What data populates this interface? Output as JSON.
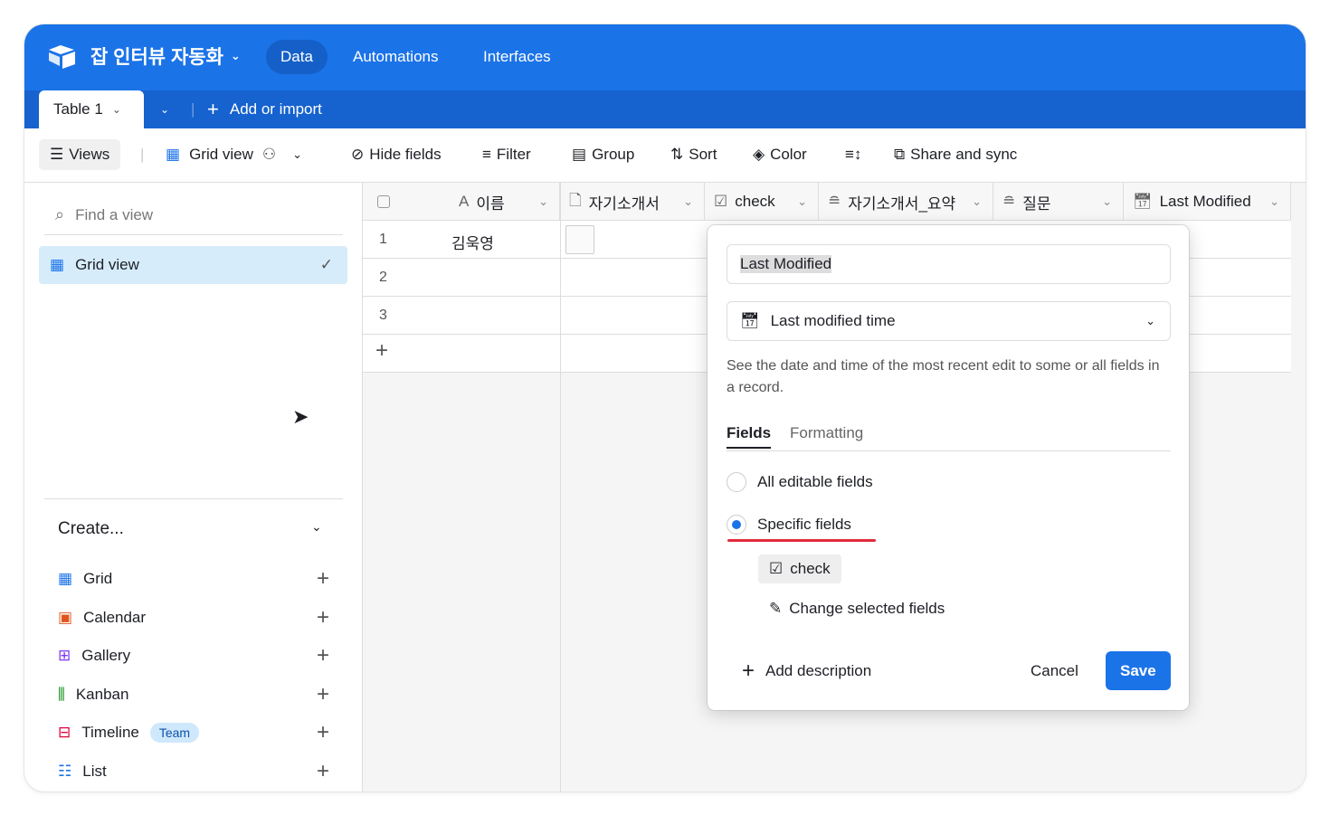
{
  "header": {
    "base_name": "잡 인터뷰 자동화",
    "nav": [
      "Data",
      "Automations",
      "Interfaces"
    ]
  },
  "tabs": {
    "table": "Table 1",
    "add": "Add or import"
  },
  "toolbar": {
    "views": "Views",
    "view_name": "Grid view",
    "hide": "Hide fields",
    "filter": "Filter",
    "group": "Group",
    "sort": "Sort",
    "color": "Color",
    "share": "Share and sync"
  },
  "sidebar": {
    "find_placeholder": "Find a view",
    "current": "Grid view",
    "create": "Create...",
    "items": [
      {
        "label": "Grid"
      },
      {
        "label": "Calendar"
      },
      {
        "label": "Gallery"
      },
      {
        "label": "Kanban"
      },
      {
        "label": "Timeline",
        "badge": "Team"
      },
      {
        "label": "List"
      }
    ]
  },
  "grid": {
    "columns": [
      "이름",
      "자기소개서",
      "check",
      "자기소개서_요약",
      "질문",
      "Last Modified"
    ],
    "rows": [
      {
        "n": "1",
        "name": "김욱영"
      },
      {
        "n": "2",
        "name": ""
      },
      {
        "n": "3",
        "name": ""
      }
    ]
  },
  "popup": {
    "field_name": "Last Modified",
    "field_type": "Last modified time",
    "description": "See the date and time of the most recent edit to some or all fields in a record.",
    "tabs": [
      "Fields",
      "Formatting"
    ],
    "options": [
      "All editable fields",
      "Specific fields"
    ],
    "selected_option": "Specific fields",
    "chip": "check",
    "change": "Change selected fields",
    "add_desc": "Add description",
    "cancel": "Cancel",
    "save": "Save"
  },
  "colors": {
    "brand": "#1b73e8",
    "underline": "#e02b3c"
  }
}
